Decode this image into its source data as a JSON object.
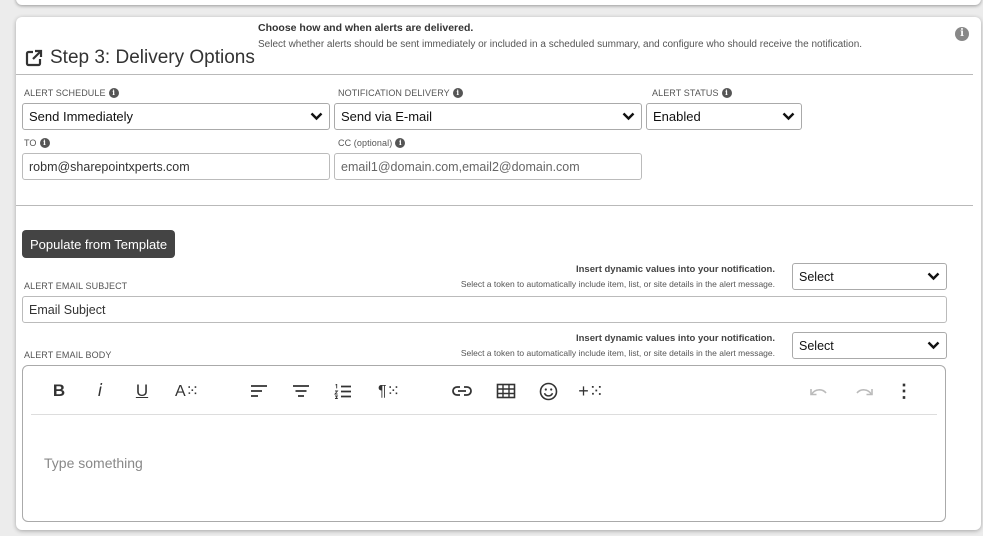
{
  "step": {
    "title": "Step 3: Delivery Options",
    "heading": "Choose how and when alerts are delivered.",
    "description": "Select whether alerts should be sent immediately or included in a scheduled summary, and configure who should receive the notification."
  },
  "fields": {
    "schedule": {
      "label": "ALERT SCHEDULE",
      "value": "Send Immediately"
    },
    "delivery": {
      "label": "NOTIFICATION DELIVERY",
      "value": "Send via E-mail"
    },
    "status": {
      "label": "ALERT STATUS",
      "value": "Enabled"
    },
    "to": {
      "label": "TO",
      "value": "robm@sharepointxperts.com"
    },
    "cc": {
      "label": "CC (optional)",
      "placeholder": "email1@domain.com,email2@domain.com"
    }
  },
  "template_button": "Populate from Template",
  "subject": {
    "label": "ALERT EMAIL SUBJECT",
    "token_title": "Insert dynamic values into your notification.",
    "token_desc": "Select a token to automatically include item, list, or site details in the alert message.",
    "token_select": "Select",
    "placeholder": "Email Subject"
  },
  "body": {
    "label": "ALERT EMAIL BODY",
    "token_title": "Insert dynamic values into your notification.",
    "token_desc": "Select a token to automatically include item, list, or site details in the alert message.",
    "token_select": "Select",
    "placeholder": "Type something"
  },
  "toolbar": {
    "bold": "B",
    "italic": "i",
    "underline": "U",
    "font": "A⁙",
    "paragraph": "¶⁙",
    "insert": "+⁙",
    "more": "⋮"
  },
  "icons": {
    "info_glyph": "i"
  }
}
